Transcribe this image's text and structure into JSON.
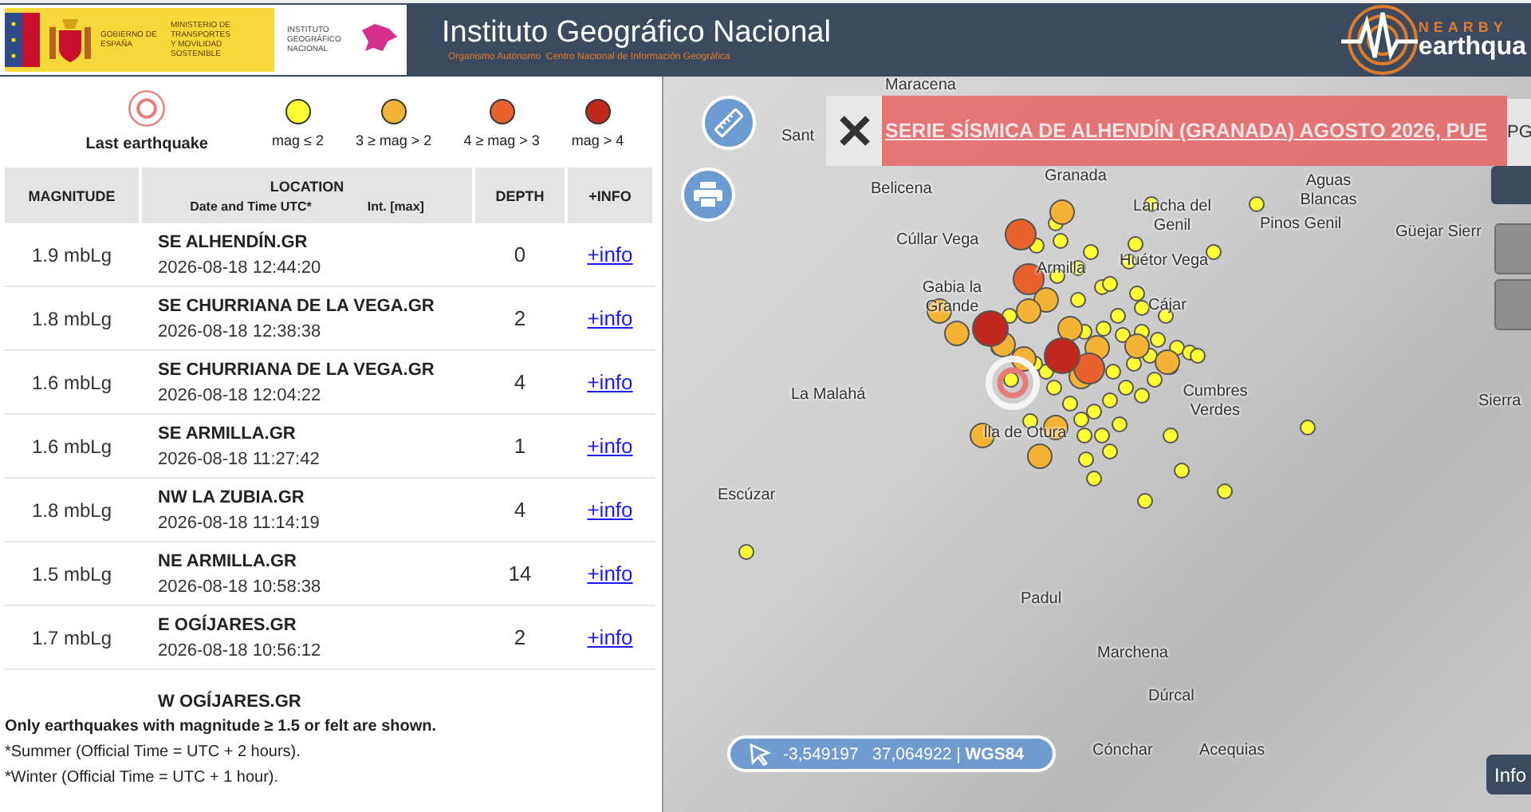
{
  "header": {
    "gov_text": "GOBIERNO DE ESPAÑA",
    "ministry_text": "MINISTERIO DE TRANSPORTES Y MOVILIDAD SOSTENIBLE",
    "ign_text": "INSTITUTO GEOGRÁFICO NACIONAL",
    "title": "Instituto Geográfico Nacional",
    "subtitle": "Organismo Autónomo  Centro Nacional de Información Geográfica",
    "brand_top": "NEARBY",
    "brand_main": "earthqua"
  },
  "legend": [
    {
      "kind": "ring",
      "label": "Last earthquake",
      "color": "#e87a7a"
    },
    {
      "kind": "dot",
      "label": "mag ≤ 2",
      "color": "#ffff33"
    },
    {
      "kind": "dot",
      "label": "3 ≥ mag > 2",
      "color": "#f5b335"
    },
    {
      "kind": "dot",
      "label": "4 ≥ mag > 3",
      "color": "#e9622d"
    },
    {
      "kind": "dot",
      "label": "mag > 4",
      "color": "#c0281e"
    }
  ],
  "table": {
    "columns": {
      "magnitude": "MAGNITUDE",
      "location": "LOCATION",
      "datetime": "Date and Time UTC*",
      "intensity": "Int. [max]",
      "depth": "DEPTH",
      "info": "+INFO"
    },
    "rows": [
      {
        "magnitude": "1.9 mbLg",
        "location": "SE ALHENDÍN.GR",
        "datetime": "2026-08-18 12:44:20",
        "depth": "0",
        "link": "+info"
      },
      {
        "magnitude": "1.8 mbLg",
        "location": "SE CHURRIANA DE LA VEGA.GR",
        "datetime": "2026-08-18 12:38:38",
        "depth": "2",
        "link": "+info"
      },
      {
        "magnitude": "1.6 mbLg",
        "location": "SE CHURRIANA DE LA VEGA.GR",
        "datetime": "2026-08-18 12:04:22",
        "depth": "4",
        "link": "+info"
      },
      {
        "magnitude": "1.6 mbLg",
        "location": "SE ARMILLA.GR",
        "datetime": "2026-08-18 11:27:42",
        "depth": "1",
        "link": "+info"
      },
      {
        "magnitude": "1.8 mbLg",
        "location": "NW LA ZUBIA.GR",
        "datetime": "2026-08-18 11:14:19",
        "depth": "4",
        "link": "+info"
      },
      {
        "magnitude": "1.5 mbLg",
        "location": "NE ARMILLA.GR",
        "datetime": "2026-08-18 10:58:38",
        "depth": "14",
        "link": "+info"
      },
      {
        "magnitude": "1.7 mbLg",
        "location": "E OGÍJARES.GR",
        "datetime": "2026-08-18 10:56:12",
        "depth": "2",
        "link": "+info"
      },
      {
        "location": "W OGÍJARES.GR"
      }
    ]
  },
  "notes": [
    {
      "kind": "bold",
      "text": "Only earthquakes with magnitude ≥ 1.5 or felt are shown."
    },
    {
      "kind": "plain",
      "text": "*Summer (Official Time = UTC + 2 hours)."
    },
    {
      "kind": "plain",
      "text": "*Winter (Official Time = UTC + 1 hour)."
    }
  ],
  "map": {
    "banner": "SERIE SÍSMICA DE ALHENDÍN (GRANADA) AGOSTO 2026, PUE",
    "side_tab": "PG",
    "info_button": "Info",
    "coordinates": "-3,549197   37,064922 | **WGS84**",
    "places": [
      "Maracena",
      "Sant",
      "Granada",
      "Belicena",
      "Lancha del Genil",
      "Aguas Blancas",
      "Pinos Genil",
      "Güejar Sierr",
      "Cúllar Vega",
      "Huétor Vega",
      "Armilla",
      "Gabia la Grande",
      "Cájar",
      "La Malahá",
      "Cumbres Verdes",
      "Sierra",
      "lla de Otura",
      "Escúzar",
      "Padul",
      "Marchena",
      "Dúrcal",
      "Cónchar",
      "Acequias"
    ]
  }
}
